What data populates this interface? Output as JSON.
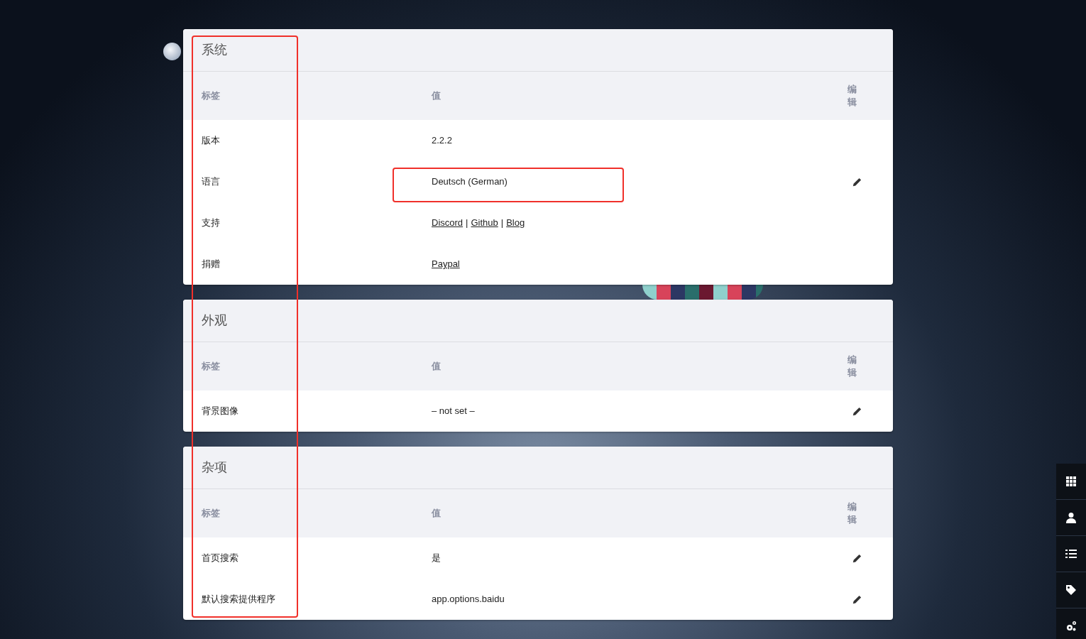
{
  "sections": [
    {
      "title": "系统",
      "columns": {
        "label": "标签",
        "value": "值",
        "edit": "编辑"
      },
      "rows": [
        {
          "label": "版本",
          "value": {
            "kind": "text",
            "text": "2.2.2"
          },
          "editable": false
        },
        {
          "label": "语言",
          "value": {
            "kind": "text",
            "text": "Deutsch (German)"
          },
          "editable": true
        },
        {
          "label": "支持",
          "value": {
            "kind": "links",
            "links": [
              "Discord",
              "Github",
              "Blog"
            ],
            "separator": "|"
          },
          "editable": false
        },
        {
          "label": "捐赠",
          "value": {
            "kind": "links",
            "links": [
              "Paypal"
            ]
          },
          "editable": false
        }
      ]
    },
    {
      "title": "外观",
      "columns": {
        "label": "标签",
        "value": "值",
        "edit": "编辑"
      },
      "rows": [
        {
          "label": "背景图像",
          "value": {
            "kind": "text",
            "text": "– not set –"
          },
          "editable": true
        }
      ]
    },
    {
      "title": "杂项",
      "columns": {
        "label": "标签",
        "value": "值",
        "edit": "编辑"
      },
      "rows": [
        {
          "label": "首页搜索",
          "value": {
            "kind": "text",
            "text": "是"
          },
          "editable": true
        },
        {
          "label": "默认搜索提供程序",
          "value": {
            "kind": "text",
            "text": "app.options.baidu"
          },
          "editable": true
        }
      ]
    }
  ]
}
